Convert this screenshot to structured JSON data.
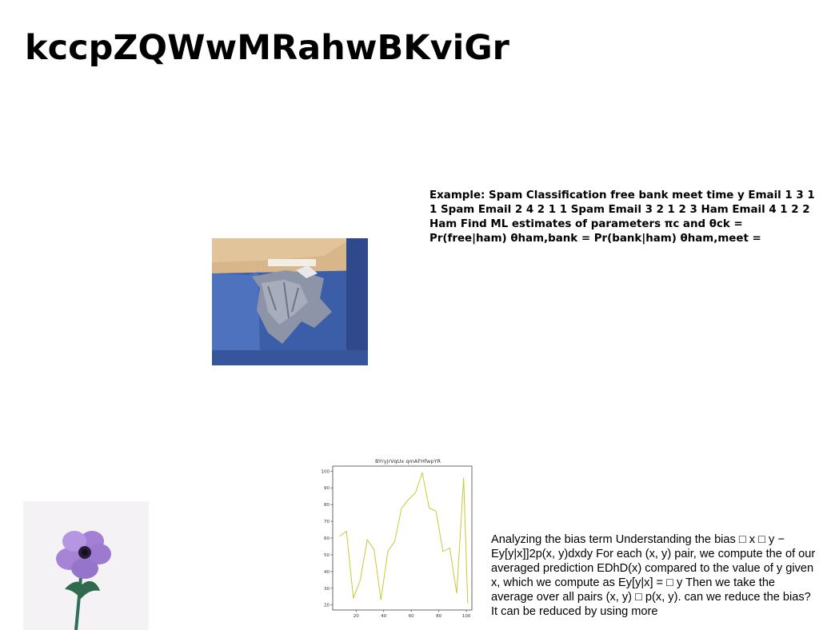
{
  "page": {
    "title": "kccpZQWwMRahwBKviGr"
  },
  "blocks": {
    "spam_text": "Example: Spam Classification free bank meet time y Email 1 3 1 1 Spam Email 2 4 2 1 1 Spam Email 3 2 1 2 3 Ham Email 4 1 2 2 Ham Find ML estimates of parameters πc and θck = Pr(free|ham) θham,bank = Pr(bank|ham) θham,meet =",
    "bias_text": "Analyzing the bias term Understanding the bias □ x □ y − Ey[y|x]]2p(x, y)dxdy For each (x, y) pair, we compute the of our averaged prediction EDhD(x) compared to the value of y given x, which we compute as Ey[y|x] = □ y Then we take the average over all pairs (x, y) □ p(x, y). can we reduce the bias? It can be reduced by using more"
  },
  "images": {
    "wall_photo_icon": "damaged-blue-wall-photo",
    "flower_photo_icon": "purple-anemone-flower-photo"
  },
  "chart_data": {
    "type": "line",
    "title": "BYryjrVqUx qmAFHfwpYR",
    "xlabel": "",
    "ylabel": "",
    "x": [
      8,
      13,
      18,
      23,
      28,
      33,
      38,
      43,
      48,
      53,
      58,
      63,
      68,
      73,
      78,
      83,
      88,
      93,
      98,
      101
    ],
    "series": [
      {
        "values": [
          61,
          64,
          24,
          35,
          59,
          53,
          23,
          52,
          58,
          78,
          83,
          87,
          99,
          78,
          76,
          52,
          54,
          27,
          96,
          21
        ]
      }
    ],
    "xlim": [
      3,
      104
    ],
    "ylim": [
      17,
      103
    ],
    "xticks": [
      20,
      40,
      60,
      80,
      100
    ],
    "yticks": [
      20,
      30,
      40,
      50,
      60,
      70,
      80,
      90,
      100
    ],
    "grid": false,
    "line_color": "#c9c93a"
  }
}
